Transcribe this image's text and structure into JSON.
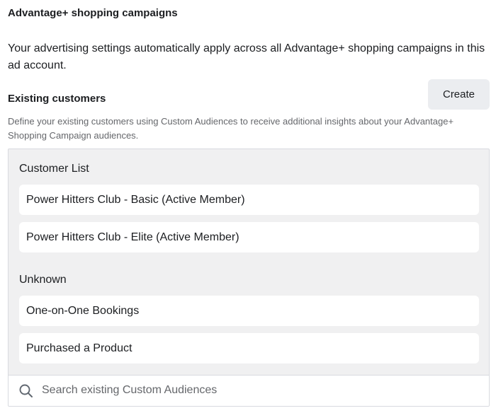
{
  "header": {
    "title": "Advantage+ shopping campaigns",
    "settings_note": "Your advertising settings automatically apply across all Advantage+ shopping campaigns in this ad account."
  },
  "existing_customers": {
    "title": "Existing customers",
    "create_label": "Create",
    "description": "Define your existing customers using Custom Audiences to receive additional insights about your Advantage+ Shopping Campaign audiences."
  },
  "groups": [
    {
      "label": "Customer List",
      "items": [
        "Power Hitters Club - Basic (Active Member)",
        "Power Hitters Club - Elite (Active Member)"
      ]
    },
    {
      "label": "Unknown",
      "items": [
        "One-on-One Bookings",
        "Purchased a Product"
      ]
    }
  ],
  "search": {
    "placeholder": "Search existing Custom Audiences",
    "icon": "search-icon"
  },
  "colors": {
    "panel_background": "#f0f0f1",
    "button_background": "#ebedf0",
    "secondary_text": "#65676b"
  }
}
